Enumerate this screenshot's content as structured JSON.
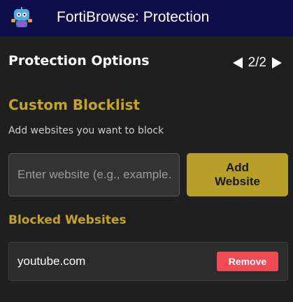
{
  "window": {
    "title": "FortiBrowse: Protection",
    "logo_icon": "robot-mascot-icon"
  },
  "header": {
    "title": "Protection Options",
    "pager": {
      "prev_icon": "triangle-left-icon",
      "next_icon": "triangle-right-icon",
      "label": "2/2"
    }
  },
  "custom_blocklist": {
    "title": "Custom Blocklist",
    "description": "Add websites you want to block",
    "input": {
      "placeholder": "Enter website (e.g., example.com)",
      "value": ""
    },
    "add_button_label": "Add\nWebsite"
  },
  "blocked_websites": {
    "title": "Blocked Websites",
    "items": [
      {
        "domain": "youtube.com",
        "remove_label": "Remove"
      }
    ]
  },
  "colors": {
    "titlebar": "#0e0e4a",
    "background": "#1f1f1f",
    "accent_gold": "#c3a32a",
    "button_gold": "#b79f2a",
    "remove_red": "#f04a54"
  }
}
